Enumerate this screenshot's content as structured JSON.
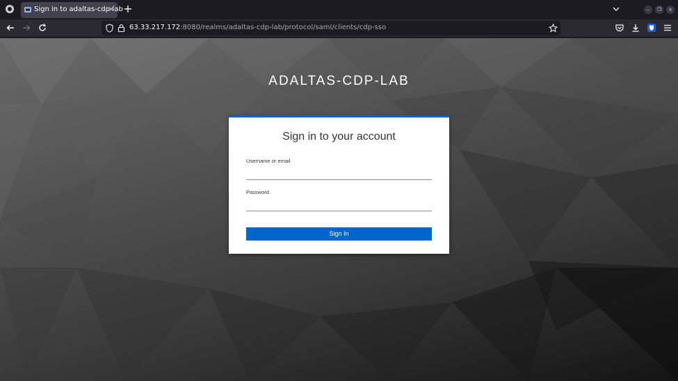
{
  "browser": {
    "tab": {
      "title": "Sign in to adaltas-cdp-lab",
      "close": "×"
    },
    "new_tab": "+",
    "window_controls": {
      "minimize": "–",
      "restore": "❐",
      "close": "×"
    },
    "url": {
      "host": "63.33.217.172",
      "rest": ":8080/realms/adaltas-cdp-lab/protocol/saml/clients/cdp-sso"
    },
    "icons": [
      "firefox-menu-icon",
      "back-arrow-icon",
      "forward-arrow-icon",
      "reload-icon",
      "shield-icon",
      "lock-icon",
      "bookmark-star-icon",
      "pocket-icon",
      "download-icon",
      "bitwarden-icon",
      "hamburger-menu-icon"
    ]
  },
  "page": {
    "realm_title": "ADALTAS-CDP-LAB",
    "card": {
      "title": "Sign in to your account",
      "username_label": "Username or email",
      "username_value": "",
      "password_label": "Password",
      "password_value": "",
      "submit_label": "Sign In"
    }
  },
  "colors": {
    "accent": "#0066cc",
    "card_bg": "#ffffff",
    "chrome_bg": "#1c1b22"
  }
}
